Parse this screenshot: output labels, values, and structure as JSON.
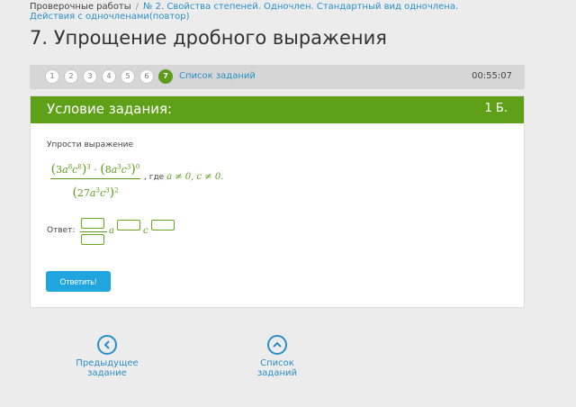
{
  "breadcrumb": {
    "root": "Проверочные работы",
    "separator": "/",
    "current": "№ 2. Свойства степеней. Одночлен. Стандартный вид одночлена. Действия с одночленами(повтор)"
  },
  "page_title": "7. Упрощение дробного выражения",
  "task_nav": {
    "pages": [
      "1",
      "2",
      "3",
      "4",
      "5",
      "6",
      "7"
    ],
    "active_page": "7",
    "task_list_label": "Список заданий",
    "timer": "00:55:07"
  },
  "task": {
    "header_title": "Условие задания:",
    "points": "1 Б.",
    "prompt": "Упрости выражение",
    "condition_text": ", где",
    "condition_math": "a ≠ 0, c ≠ 0.",
    "answer_label": "Ответ:",
    "answer_vars": [
      "a",
      "c"
    ],
    "submit_label": "Ответить!"
  },
  "footer_nav": {
    "prev_label": "Предыдущее задание",
    "list_label": "Список заданий"
  },
  "colors": {
    "accent_green": "#5ea018",
    "link_blue": "#2a8fc6",
    "button_blue": "#20a6df"
  }
}
